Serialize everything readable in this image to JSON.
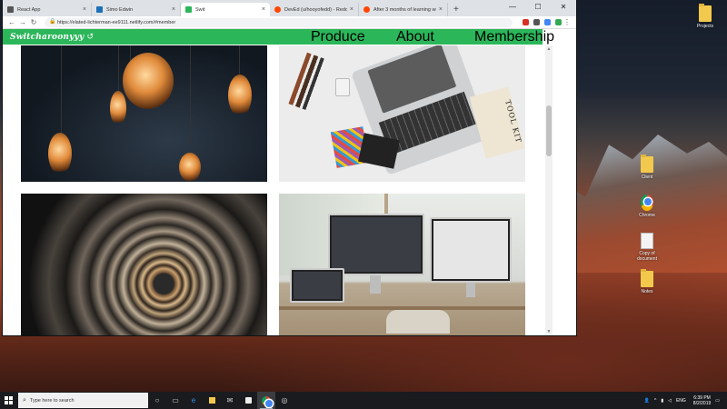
{
  "desktop": {
    "icons": [
      {
        "label": "Projects",
        "kind": "folder"
      },
      {
        "label": "Client",
        "kind": "folder"
      },
      {
        "label": "Chrome",
        "kind": "chrome"
      },
      {
        "label": "Copy of document",
        "kind": "doc"
      },
      {
        "label": "Notes",
        "kind": "folder"
      }
    ]
  },
  "browser": {
    "tabs": [
      {
        "title": "React App",
        "fav_color": "#555555",
        "close": "×"
      },
      {
        "title": "Simo Edwin",
        "fav_color": "#1b6fb8",
        "close": "×"
      },
      {
        "title": "Swit",
        "fav_color": "#2bb65a",
        "close": "×"
      },
      {
        "title": "DevEd (u/hooyofedd) - Reddit",
        "fav_color": "#ff4500",
        "close": "×"
      },
      {
        "title": "After 3 months of learning webd",
        "fav_color": "#ff4500",
        "close": "×"
      }
    ],
    "new_tab": "+",
    "window_controls": {
      "minimize": "—",
      "maximize": "☐",
      "close": "✕"
    },
    "nav": {
      "back": "←",
      "forward": "→",
      "reload": "↻",
      "lock": "🔒"
    },
    "url": "https://elated-lichterman-ee9111.netlify.com/#member",
    "extension_colors": [
      "#d93025",
      "#555555",
      "#4285f4",
      "#34a853"
    ]
  },
  "site": {
    "logo": "Switcharoonyyy",
    "logo_mark": "↺",
    "nav": [
      "Produce",
      "About",
      "Membership"
    ],
    "header_color": "#2bb65a",
    "photos": [
      {
        "subject": "hanging-edison-bulbs"
      },
      {
        "subject": "laptop-desk-tool-kit",
        "tag": "TOOL KIT"
      },
      {
        "subject": "spiral-staircase"
      },
      {
        "subject": "desk-monitors"
      }
    ]
  },
  "taskbar": {
    "search_placeholder": "Type here to search",
    "lang": "ENG",
    "time": "6:39 PM",
    "date": "8/2/2019"
  }
}
